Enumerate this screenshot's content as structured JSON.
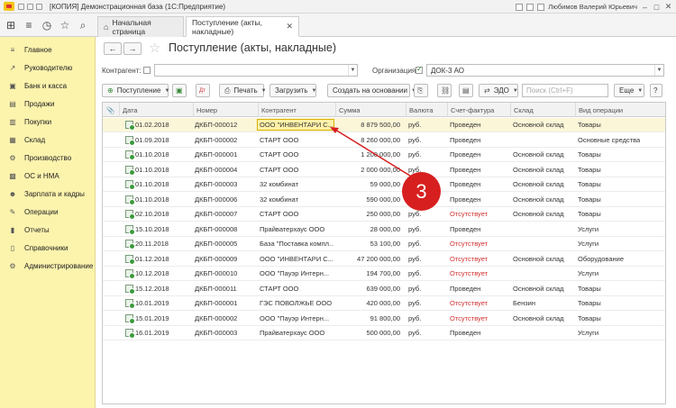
{
  "titlebar": {
    "title": "[КОПИЯ] Демонстрационная база (1С:Предприятие)",
    "user": "Любимов Валерий Юрьевич",
    "win_min": "–",
    "win_max": "□",
    "win_close": "✕"
  },
  "tabs": {
    "home_label": "Начальная страница",
    "active_label": "Поступление (акты, накладные)"
  },
  "sidebar": {
    "items": [
      {
        "label": "Главное",
        "icon": "≡"
      },
      {
        "label": "Руководителю",
        "icon": "↗"
      },
      {
        "label": "Банк и касса",
        "icon": "▣"
      },
      {
        "label": "Продажи",
        "icon": "▤"
      },
      {
        "label": "Покупки",
        "icon": "▥"
      },
      {
        "label": "Склад",
        "icon": "▦"
      },
      {
        "label": "Производство",
        "icon": "⚙"
      },
      {
        "label": "ОС и НМА",
        "icon": "▩"
      },
      {
        "label": "Зарплата и кадры",
        "icon": "☻"
      },
      {
        "label": "Операции",
        "icon": "✎"
      },
      {
        "label": "Отчеты",
        "icon": "▮"
      },
      {
        "label": "Справочники",
        "icon": "▯"
      },
      {
        "label": "Администрирование",
        "icon": "⚙"
      }
    ]
  },
  "page": {
    "title": "Поступление (акты, накладные)",
    "back": "←",
    "forward": "→",
    "star": "☆"
  },
  "filters": {
    "contractor_label": "Контрагент:",
    "organization_label": "Организация:",
    "organization_value": "ДОК-3 АО"
  },
  "toolbar": {
    "postuplenie": "Поступление",
    "print": "Печать",
    "load": "Загрузить",
    "create_basis": "Создать на основании",
    "edo": "ЭДО",
    "search_placeholder": "Поиск (Ctrl+F)",
    "more": "Еще",
    "help": "?"
  },
  "table": {
    "headers": [
      "Дата",
      "Номер",
      "Контрагент",
      "Сумма",
      "Валюта",
      "Счет-фактура",
      "Склад",
      "Вид операции"
    ],
    "rows": [
      {
        "date": "01.02.2018",
        "number": "ДКБП-000012",
        "contractor": "ООО \"ИНВЕНТАРИ С...",
        "sum": "8 879 500,00",
        "currency": "руб.",
        "invoice": "Проведен",
        "warehouse": "Основной склад",
        "operation": "Товары",
        "selected": true
      },
      {
        "date": "01.09.2018",
        "number": "ДКБП-000002",
        "contractor": "СТАРТ ООО",
        "sum": "8 260 000,00",
        "currency": "руб.",
        "invoice": "Проведен",
        "warehouse": "",
        "operation": "Основные средства"
      },
      {
        "date": "01.10.2018",
        "number": "ДКБП-000001",
        "contractor": "СТАРТ ООО",
        "sum": "1 200 000,00",
        "currency": "руб.",
        "invoice": "Проведен",
        "warehouse": "Основной склад",
        "operation": "Товары"
      },
      {
        "date": "01.10.2018",
        "number": "ДКБП-000004",
        "contractor": "СТАРТ ООО",
        "sum": "2 000 000,00",
        "currency": "руб.",
        "invoice": "Проведен",
        "warehouse": "Основной склад",
        "operation": "Товары"
      },
      {
        "date": "01.10.2018",
        "number": "ДКБП-000003",
        "contractor": "32 комбинат",
        "sum": "59 000,00",
        "currency": "руб.",
        "invoice": "Проведен",
        "warehouse": "Основной склад",
        "operation": "Товары"
      },
      {
        "date": "01.10.2018",
        "number": "ДКБП-000006",
        "contractor": "32 комбинат",
        "sum": "590 000,00",
        "currency": "руб.",
        "invoice": "Проведен",
        "warehouse": "Основной склад",
        "operation": "Товары"
      },
      {
        "date": "02.10.2018",
        "number": "ДКБП-000007",
        "contractor": "СТАРТ ООО",
        "sum": "250 000,00",
        "currency": "руб.",
        "invoice": "Отсутствует",
        "warehouse": "Основной склад",
        "operation": "Товары"
      },
      {
        "date": "15.10.2018",
        "number": "ДКБП-000008",
        "contractor": "Прайватерхаус ООО",
        "sum": "28 000,00",
        "currency": "руб.",
        "invoice": "Проведен",
        "warehouse": "",
        "operation": "Услуги"
      },
      {
        "date": "20.11.2018",
        "number": "ДКБП-000005",
        "contractor": "База \"Поставка компл...",
        "sum": "53 100,00",
        "currency": "руб.",
        "invoice": "Отсутствует",
        "warehouse": "",
        "operation": "Услуги"
      },
      {
        "date": "01.12.2018",
        "number": "ДКБП-000009",
        "contractor": "ООО \"ИНВЕНТАРИ С...",
        "sum": "47 200 000,00",
        "currency": "руб.",
        "invoice": "Отсутствует",
        "warehouse": "Основной склад",
        "operation": "Оборудование"
      },
      {
        "date": "10.12.2018",
        "number": "ДКБП-000010",
        "contractor": "ООО \"Пауэр Интерн...",
        "sum": "194 700,00",
        "currency": "руб.",
        "invoice": "Отсутствует",
        "warehouse": "",
        "operation": "Услуги"
      },
      {
        "date": "15.12.2018",
        "number": "ДКБП-000011",
        "contractor": "СТАРТ ООО",
        "sum": "639 000,00",
        "currency": "руб.",
        "invoice": "Проведен",
        "warehouse": "Основной склад",
        "operation": "Товары"
      },
      {
        "date": "10.01.2019",
        "number": "ДКБП-000001",
        "contractor": "ГЭС ПОВОЛЖЬЕ ООО",
        "sum": "420 000,00",
        "currency": "руб.",
        "invoice": "Отсутствует",
        "warehouse": "Бензин",
        "operation": "Товары"
      },
      {
        "date": "15.01.2019",
        "number": "ДКБП-000002",
        "contractor": "ООО \"Пауэр Интерн...",
        "sum": "91 800,00",
        "currency": "руб.",
        "invoice": "Отсутствует",
        "warehouse": "Основной склад",
        "operation": "Товары"
      },
      {
        "date": "16.01.2019",
        "number": "ДКБП-000003",
        "contractor": "Прайватерхаус ООО",
        "sum": "500 000,00",
        "currency": "руб.",
        "invoice": "Проведен",
        "warehouse": "",
        "operation": "Услуги"
      }
    ]
  },
  "annotation": {
    "label": "3"
  },
  "colors": {
    "sidebar_bg": "#fcf3ad",
    "selected_cell": "#fff1a8",
    "red_status": "#d23030",
    "annotation": "#d71f1f"
  }
}
